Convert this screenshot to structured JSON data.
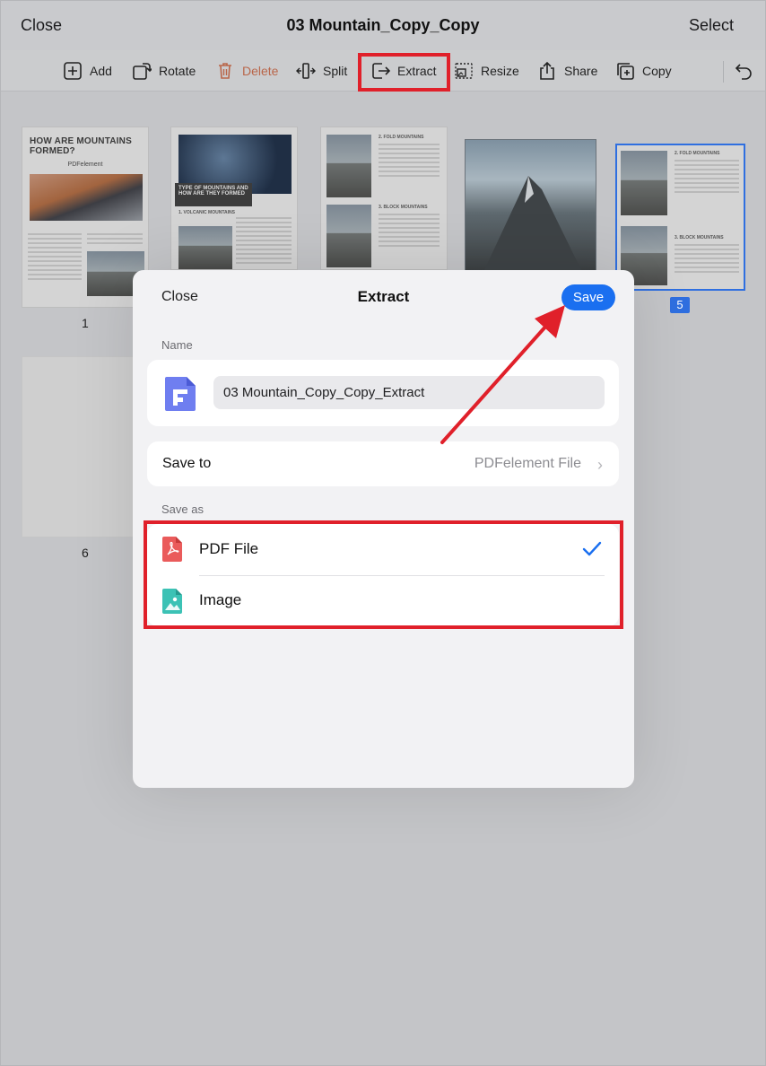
{
  "nav": {
    "close": "Close",
    "title": "03 Mountain_Copy_Copy",
    "select": "Select"
  },
  "toolbar": {
    "add": "Add",
    "rotate": "Rotate",
    "delete": "Delete",
    "split": "Split",
    "extract": "Extract",
    "resize": "Resize",
    "share": "Share",
    "copy": "Copy",
    "colors": {
      "delete": "#b9664a",
      "highlight": "#e0202a"
    }
  },
  "pages": {
    "p1": {
      "label": "1",
      "heading": "HOW ARE MOUNTAINS FORMED?",
      "brand": "PDFelement"
    },
    "p2": {
      "heading": "TYPE OF MOUNTAINS AND HOW ARE THEY FORMED",
      "section": "1. VOLCANIC MOUNTAINS"
    },
    "p3": {
      "section_a": "2. FOLD MOUNTAINS",
      "section_b": "3. BLOCK MOUNTAINS"
    },
    "p5": {
      "label": "5",
      "section_a": "2. FOLD MOUNTAINS",
      "section_b": "3. BLOCK MOUNTAINS"
    },
    "p6": {
      "label": "6"
    }
  },
  "modal": {
    "close": "Close",
    "title": "Extract",
    "save": "Save",
    "name_label": "Name",
    "name_value": "03 Mountain_Copy_Copy_Extract",
    "save_to_label": "Save to",
    "save_to_value": "PDFelement File",
    "save_as_label": "Save as",
    "options": [
      {
        "label": "PDF File",
        "icon": "pdf-file-icon",
        "selected": true
      },
      {
        "label": "Image",
        "icon": "image-file-icon",
        "selected": false
      }
    ],
    "colors": {
      "accent": "#1a6ff0",
      "highlight": "#e0202a"
    }
  }
}
